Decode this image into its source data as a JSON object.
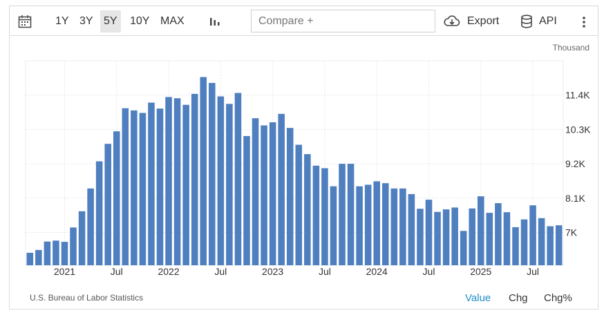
{
  "toolbar": {
    "ranges": [
      "1Y",
      "3Y",
      "5Y",
      "10Y",
      "MAX"
    ],
    "active_range": "5Y",
    "compare_placeholder": "Compare +",
    "export_label": "Export",
    "api_label": "API"
  },
  "unit_label": "Thousand",
  "source": "U.S. Bureau of Labor Statistics",
  "modes": [
    "Value",
    "Chg",
    "Chg%"
  ],
  "active_mode": "Value",
  "colors": {
    "bar": "#4f7fbf",
    "accent": "#1f8ec7",
    "grid": "#e6e6e6"
  },
  "chart_data": {
    "type": "bar",
    "y_tick_labels": [
      "7K",
      "8.1K",
      "9.2K",
      "10.3K",
      "11.4K"
    ],
    "y_ticks": [
      7.0,
      8.1,
      9.2,
      10.3,
      11.4
    ],
    "ylim": [
      5.95,
      12.5
    ],
    "x_tick_labels": [
      "2021",
      "Jul",
      "2022",
      "Jul",
      "2023",
      "Jul",
      "2024",
      "Jul",
      "2025",
      "Jul"
    ],
    "x": [
      "2020-09",
      "2020-10",
      "2020-11",
      "2020-12",
      "2021-01",
      "2021-02",
      "2021-03",
      "2021-04",
      "2021-05",
      "2021-06",
      "2021-07",
      "2021-08",
      "2021-09",
      "2021-10",
      "2021-11",
      "2021-12",
      "2022-01",
      "2022-02",
      "2022-03",
      "2022-04",
      "2022-05",
      "2022-06",
      "2022-07",
      "2022-08",
      "2022-09",
      "2022-10",
      "2022-11",
      "2022-12",
      "2023-01",
      "2023-02",
      "2023-03",
      "2023-04",
      "2023-05",
      "2023-06",
      "2023-07",
      "2023-08",
      "2023-09",
      "2023-10",
      "2023-11",
      "2023-12",
      "2024-01",
      "2024-02",
      "2024-03",
      "2024-04",
      "2024-05",
      "2024-06",
      "2024-07",
      "2024-08",
      "2024-09",
      "2024-10",
      "2024-11",
      "2024-12",
      "2025-01",
      "2025-02",
      "2025-03",
      "2025-04",
      "2025-05",
      "2025-06",
      "2025-07",
      "2025-08"
    ],
    "values": [
      6.35,
      6.44,
      6.71,
      6.74,
      6.7,
      7.16,
      7.68,
      8.41,
      9.28,
      9.84,
      10.24,
      10.98,
      10.91,
      10.83,
      11.16,
      10.97,
      11.34,
      11.3,
      11.09,
      11.44,
      11.98,
      11.79,
      11.36,
      11.12,
      11.47,
      10.09,
      10.66,
      10.43,
      10.53,
      10.8,
      10.35,
      9.81,
      9.51,
      9.14,
      9.06,
      8.48,
      9.2,
      9.2,
      8.48,
      8.53,
      8.64,
      8.58,
      8.41,
      8.41,
      8.23,
      7.76,
      8.05,
      7.66,
      7.74,
      7.8,
      7.05,
      7.77,
      8.16,
      7.63,
      7.94,
      7.65,
      7.17,
      7.42,
      7.87,
      7.46,
      7.2,
      7.23
    ]
  }
}
